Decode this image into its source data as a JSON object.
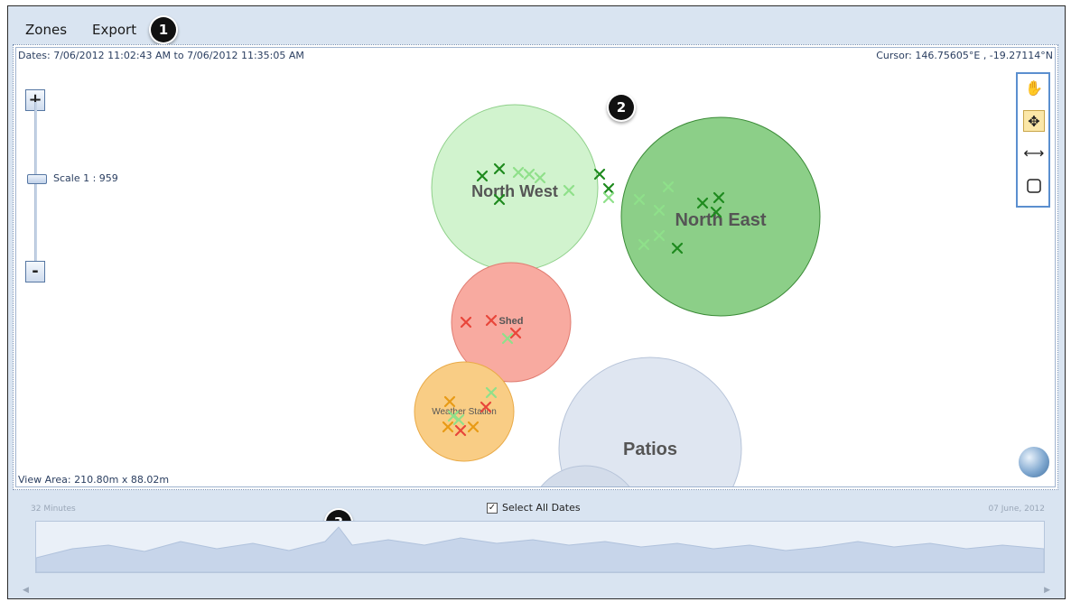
{
  "menu": {
    "zones": "Zones",
    "export": "Export"
  },
  "badges": {
    "b1": "1",
    "b2": "2",
    "b3": "3"
  },
  "map": {
    "dates": "Dates: 7/06/2012 11:02:43 AM to 7/06/2012 11:35:05 AM",
    "cursor": "Cursor: 146.75605°E , -19.27114°N",
    "view_area": "View Area: 210.80m x 88.02m",
    "scale": "Scale 1 : 959",
    "zoom_in": "+",
    "zoom_out": "-",
    "tools": [
      "pan-hand-icon",
      "move-arrows-icon",
      "measure-icon",
      "select-rectangle-icon"
    ],
    "active_tool": "move-arrows-icon"
  },
  "zones": [
    {
      "name": "North West",
      "color": "#aee9a9"
    },
    {
      "name": "North East",
      "color": "#6ebf6b"
    },
    {
      "name": "Shed",
      "color": "#f48a7d"
    },
    {
      "name": "Weather Station",
      "color": "#f6b54f"
    },
    {
      "name": "Patios",
      "color": "#c9d4e6"
    }
  ],
  "colors": {
    "marker_dark_green": "#1e8a1e",
    "marker_light_green": "#8fe08a",
    "marker_red": "#e8463a",
    "marker_orange": "#e89a16"
  },
  "timeline": {
    "left_label": "32 Minutes",
    "right_label": "07 June, 2012",
    "select_all": "Select All Dates",
    "select_all_checked": true
  }
}
